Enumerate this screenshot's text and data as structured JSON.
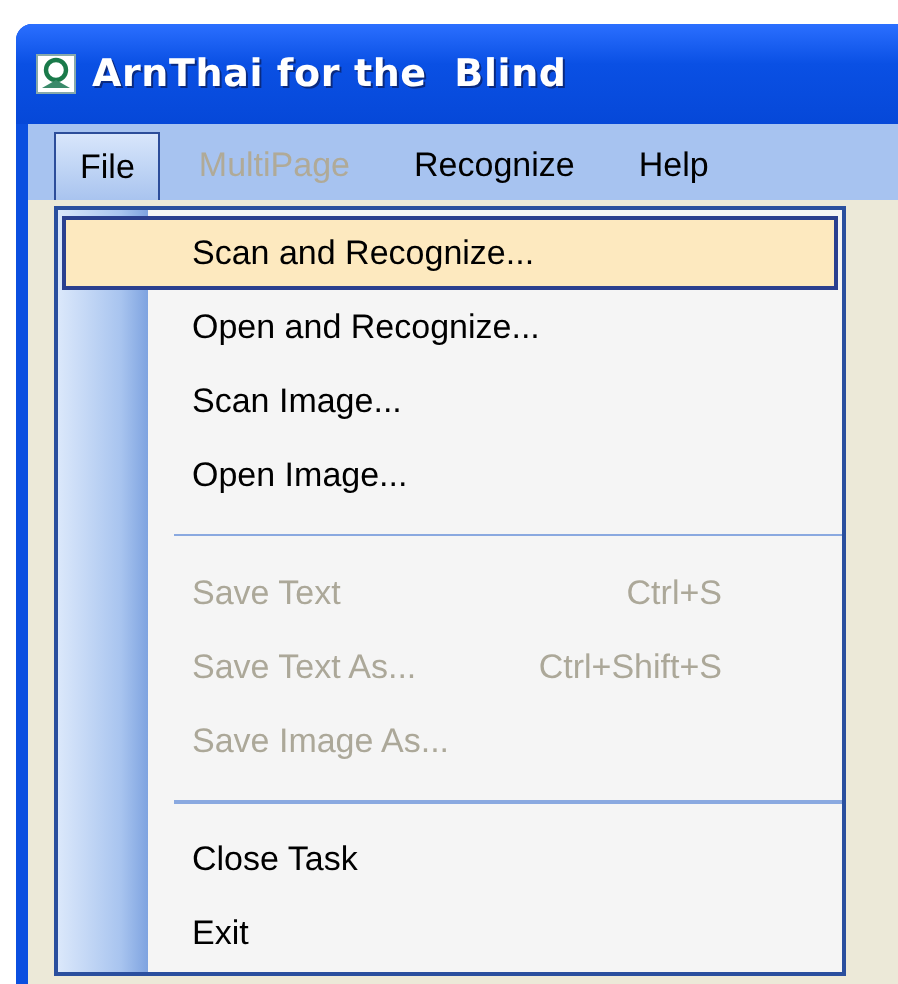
{
  "window": {
    "title": "ArnThai for the  Blind"
  },
  "menu_bar": [
    {
      "label": "File",
      "selected": true,
      "disabled": false
    },
    {
      "label": "MultiPage",
      "selected": false,
      "disabled": true
    },
    {
      "label": "Recognize",
      "selected": false,
      "disabled": false
    },
    {
      "label": "Help",
      "selected": false,
      "disabled": false
    }
  ],
  "file_menu": [
    {
      "kind": "command",
      "label": "Scan and Recognize...",
      "selected": true,
      "disabled": false
    },
    {
      "kind": "command",
      "label": "Open and Recognize...",
      "selected": false,
      "disabled": false
    },
    {
      "kind": "command",
      "label": "Scan Image...",
      "selected": false,
      "disabled": false
    },
    {
      "kind": "command",
      "label": "Open Image...",
      "selected": false,
      "disabled": false
    },
    {
      "kind": "separator"
    },
    {
      "kind": "command",
      "label": "Save Text",
      "shortcut": "Ctrl+S",
      "selected": false,
      "disabled": true
    },
    {
      "kind": "command",
      "label": "Save Text As...",
      "shortcut": "Ctrl+Shift+S",
      "selected": false,
      "disabled": true
    },
    {
      "kind": "command",
      "label": "Save Image As...",
      "selected": false,
      "disabled": true
    },
    {
      "kind": "separator"
    },
    {
      "kind": "command",
      "label": "Close Task",
      "selected": false,
      "disabled": false
    },
    {
      "kind": "command",
      "label": "Exit",
      "selected": false,
      "disabled": false
    }
  ]
}
